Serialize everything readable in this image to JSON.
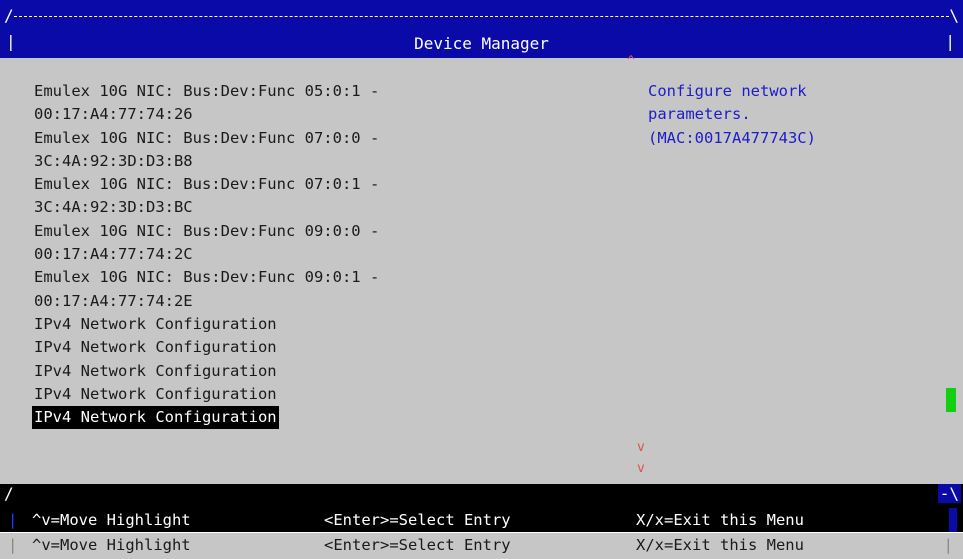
{
  "window": {
    "title": "Device Manager"
  },
  "menu": {
    "items": [
      {
        "label": "Emulex 10G NIC: Bus:Dev:Func 05:0:1 -"
      },
      {
        "label": "00:17:A4:77:74:26"
      },
      {
        "label": "Emulex 10G NIC: Bus:Dev:Func 07:0:0 -"
      },
      {
        "label": "3C:4A:92:3D:D3:B8"
      },
      {
        "label": "Emulex 10G NIC: Bus:Dev:Func 07:0:1 -"
      },
      {
        "label": "3C:4A:92:3D:D3:BC"
      },
      {
        "label": "Emulex 10G NIC: Bus:Dev:Func 09:0:0 -"
      },
      {
        "label": "00:17:A4:77:74:2C"
      },
      {
        "label": "Emulex 10G NIC: Bus:Dev:Func 09:0:1 -"
      },
      {
        "label": "00:17:A4:77:74:2E"
      },
      {
        "label": "IPv4 Network Configuration"
      },
      {
        "label": "IPv4 Network Configuration"
      },
      {
        "label": "IPv4 Network Configuration"
      },
      {
        "label": "IPv4 Network Configuration"
      },
      {
        "label": "IPv4 Network Configuration"
      }
    ],
    "selected_index": 14
  },
  "help": {
    "lines": [
      "Configure network",
      "parameters.",
      "(MAC:0017A477743C)"
    ]
  },
  "indicators": {
    "scroll_up": "^",
    "scroll_down": "v"
  },
  "footer": {
    "rows": [
      {
        "move": "^v=Move Highlight",
        "enter": "<Enter>=Select Entry",
        "exit": "X/x=Exit this Menu"
      },
      {
        "move": "^v=Move Highlight",
        "enter": "<Enter>=Select Entry",
        "exit": "X/x=Exit this Menu"
      }
    ]
  },
  "colors": {
    "title_bg": "#0a0aa8",
    "body_bg": "#c6c6c6",
    "help_text": "#1c1cc8",
    "arrow": "#e05050",
    "scroll_thumb": "#10d010"
  }
}
